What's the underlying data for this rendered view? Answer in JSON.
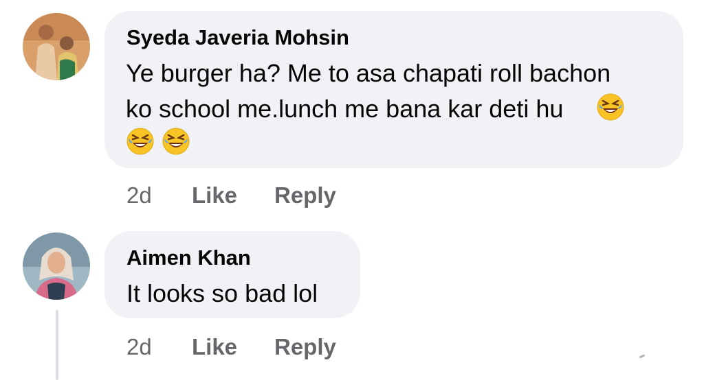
{
  "comments": [
    {
      "author": "Syeda Javeria Mohsin",
      "lines": [
        "Ye burger ha? Me to asa chapati roll bachon",
        "ko school me.lunch me bana kar deti hu"
      ],
      "emoji": "rolling-on-the-floor-laughing-emoji",
      "time": "2d",
      "like_label": "Like",
      "reply_label": "Reply"
    },
    {
      "author": "Aimen Khan",
      "lines": [
        "It looks so bad lol"
      ],
      "time": "2d",
      "like_label": "Like",
      "reply_label": "Reply"
    }
  ],
  "colors": {
    "bubble": "#f0f2f5",
    "text": "#050505",
    "meta": "#65676b",
    "emoji_face": "#f7c325"
  }
}
